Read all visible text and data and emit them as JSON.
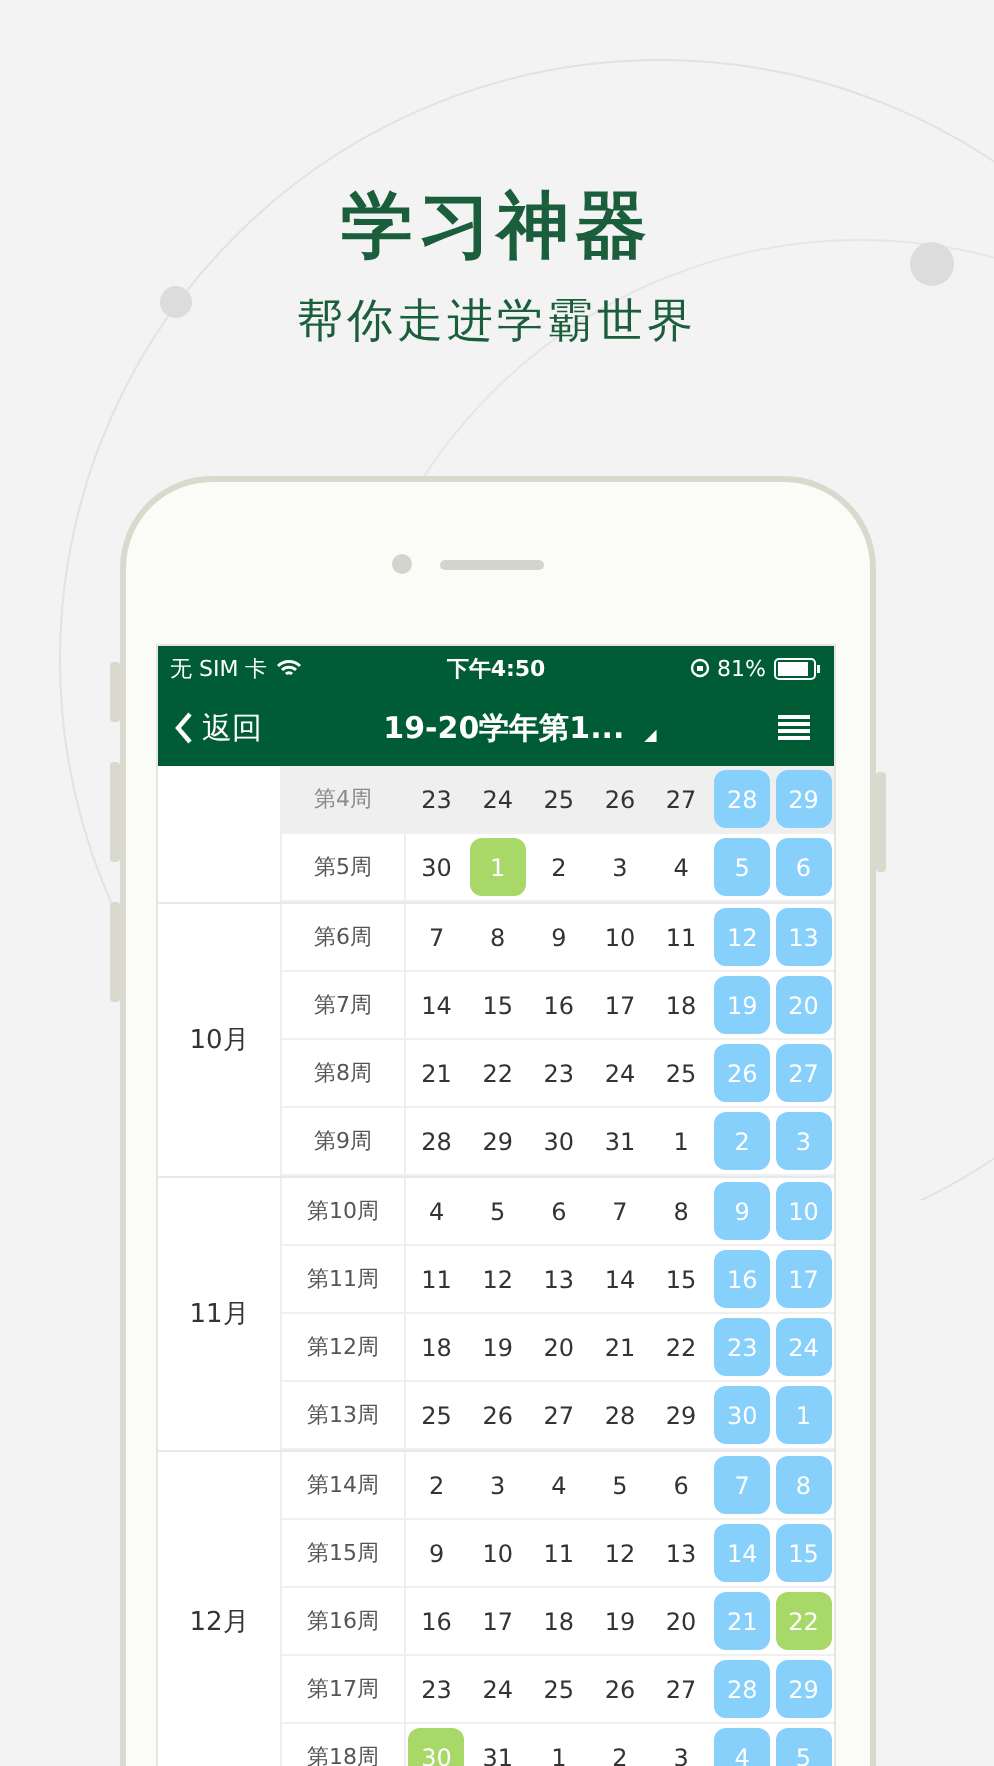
{
  "headline": "学习神器",
  "subtitle": "帮你走进学霸世界",
  "status_bar": {
    "carrier": "无 SIM 卡",
    "time": "下午4:50",
    "battery": "81%"
  },
  "nav_bar": {
    "back": "返回",
    "title": "19-20学年第1...",
    "dropdown": "◢"
  },
  "months": [
    {
      "weeks": [
        {
          "label": "第4周",
          "selected": true,
          "days": [
            {
              "d": "23",
              "kind": "plain"
            },
            {
              "d": "24",
              "kind": "plain"
            },
            {
              "d": "25",
              "kind": "plain"
            },
            {
              "d": "26",
              "kind": "plain"
            },
            {
              "d": "27",
              "kind": "plain"
            },
            {
              "d": "28",
              "kind": "weekend"
            },
            {
              "d": "29",
              "kind": "weekend"
            }
          ]
        },
        {
          "label": "第5周",
          "selected": false,
          "days": [
            {
              "d": "30",
              "kind": "plain"
            },
            {
              "d": "1",
              "kind": "marked"
            },
            {
              "d": "2",
              "kind": "plain"
            },
            {
              "d": "3",
              "kind": "plain"
            },
            {
              "d": "4",
              "kind": "plain"
            },
            {
              "d": "5",
              "kind": "weekend"
            },
            {
              "d": "6",
              "kind": "weekend"
            }
          ]
        }
      ]
    },
    {
      "label": "10月",
      "weeks": [
        {
          "label": "第6周",
          "selected": false,
          "days": [
            {
              "d": "7",
              "kind": "plain"
            },
            {
              "d": "8",
              "kind": "plain"
            },
            {
              "d": "9",
              "kind": "plain"
            },
            {
              "d": "10",
              "kind": "plain"
            },
            {
              "d": "11",
              "kind": "plain"
            },
            {
              "d": "12",
              "kind": "weekend"
            },
            {
              "d": "13",
              "kind": "weekend"
            }
          ]
        },
        {
          "label": "第7周",
          "selected": false,
          "days": [
            {
              "d": "14",
              "kind": "plain"
            },
            {
              "d": "15",
              "kind": "plain"
            },
            {
              "d": "16",
              "kind": "plain"
            },
            {
              "d": "17",
              "kind": "plain"
            },
            {
              "d": "18",
              "kind": "plain"
            },
            {
              "d": "19",
              "kind": "weekend"
            },
            {
              "d": "20",
              "kind": "weekend"
            }
          ]
        },
        {
          "label": "第8周",
          "selected": false,
          "days": [
            {
              "d": "21",
              "kind": "plain"
            },
            {
              "d": "22",
              "kind": "plain"
            },
            {
              "d": "23",
              "kind": "plain"
            },
            {
              "d": "24",
              "kind": "plain"
            },
            {
              "d": "25",
              "kind": "plain"
            },
            {
              "d": "26",
              "kind": "weekend"
            },
            {
              "d": "27",
              "kind": "weekend"
            }
          ]
        },
        {
          "label": "第9周",
          "selected": false,
          "days": [
            {
              "d": "28",
              "kind": "plain"
            },
            {
              "d": "29",
              "kind": "plain"
            },
            {
              "d": "30",
              "kind": "plain"
            },
            {
              "d": "31",
              "kind": "plain"
            },
            {
              "d": "1",
              "kind": "plain"
            },
            {
              "d": "2",
              "kind": "weekend"
            },
            {
              "d": "3",
              "kind": "weekend"
            }
          ]
        }
      ]
    },
    {
      "label": "11月",
      "weeks": [
        {
          "label": "第10周",
          "selected": false,
          "days": [
            {
              "d": "4",
              "kind": "plain"
            },
            {
              "d": "5",
              "kind": "plain"
            },
            {
              "d": "6",
              "kind": "plain"
            },
            {
              "d": "7",
              "kind": "plain"
            },
            {
              "d": "8",
              "kind": "plain"
            },
            {
              "d": "9",
              "kind": "weekend"
            },
            {
              "d": "10",
              "kind": "weekend"
            }
          ]
        },
        {
          "label": "第11周",
          "selected": false,
          "days": [
            {
              "d": "11",
              "kind": "plain"
            },
            {
              "d": "12",
              "kind": "plain"
            },
            {
              "d": "13",
              "kind": "plain"
            },
            {
              "d": "14",
              "kind": "plain"
            },
            {
              "d": "15",
              "kind": "plain"
            },
            {
              "d": "16",
              "kind": "weekend"
            },
            {
              "d": "17",
              "kind": "weekend"
            }
          ]
        },
        {
          "label": "第12周",
          "selected": false,
          "days": [
            {
              "d": "18",
              "kind": "plain"
            },
            {
              "d": "19",
              "kind": "plain"
            },
            {
              "d": "20",
              "kind": "plain"
            },
            {
              "d": "21",
              "kind": "plain"
            },
            {
              "d": "22",
              "kind": "plain"
            },
            {
              "d": "23",
              "kind": "weekend"
            },
            {
              "d": "24",
              "kind": "weekend"
            }
          ]
        },
        {
          "label": "第13周",
          "selected": false,
          "days": [
            {
              "d": "25",
              "kind": "plain"
            },
            {
              "d": "26",
              "kind": "plain"
            },
            {
              "d": "27",
              "kind": "plain"
            },
            {
              "d": "28",
              "kind": "plain"
            },
            {
              "d": "29",
              "kind": "plain"
            },
            {
              "d": "30",
              "kind": "weekend"
            },
            {
              "d": "1",
              "kind": "weekend"
            }
          ]
        }
      ]
    },
    {
      "label": "12月",
      "weeks": [
        {
          "label": "第14周",
          "selected": false,
          "days": [
            {
              "d": "2",
              "kind": "plain"
            },
            {
              "d": "3",
              "kind": "plain"
            },
            {
              "d": "4",
              "kind": "plain"
            },
            {
              "d": "5",
              "kind": "plain"
            },
            {
              "d": "6",
              "kind": "plain"
            },
            {
              "d": "7",
              "kind": "weekend"
            },
            {
              "d": "8",
              "kind": "weekend"
            }
          ]
        },
        {
          "label": "第15周",
          "selected": false,
          "days": [
            {
              "d": "9",
              "kind": "plain"
            },
            {
              "d": "10",
              "kind": "plain"
            },
            {
              "d": "11",
              "kind": "plain"
            },
            {
              "d": "12",
              "kind": "plain"
            },
            {
              "d": "13",
              "kind": "plain"
            },
            {
              "d": "14",
              "kind": "weekend"
            },
            {
              "d": "15",
              "kind": "weekend"
            }
          ]
        },
        {
          "label": "第16周",
          "selected": false,
          "days": [
            {
              "d": "16",
              "kind": "plain"
            },
            {
              "d": "17",
              "kind": "plain"
            },
            {
              "d": "18",
              "kind": "plain"
            },
            {
              "d": "19",
              "kind": "plain"
            },
            {
              "d": "20",
              "kind": "plain"
            },
            {
              "d": "21",
              "kind": "weekend"
            },
            {
              "d": "22",
              "kind": "marked"
            }
          ]
        },
        {
          "label": "第17周",
          "selected": false,
          "days": [
            {
              "d": "23",
              "kind": "plain"
            },
            {
              "d": "24",
              "kind": "plain"
            },
            {
              "d": "25",
              "kind": "plain"
            },
            {
              "d": "26",
              "kind": "plain"
            },
            {
              "d": "27",
              "kind": "plain"
            },
            {
              "d": "28",
              "kind": "weekend"
            },
            {
              "d": "29",
              "kind": "weekend"
            }
          ]
        },
        {
          "label": "第18周",
          "selected": false,
          "days": [
            {
              "d": "30",
              "kind": "marked"
            },
            {
              "d": "31",
              "kind": "plain"
            },
            {
              "d": "1",
              "kind": "plain"
            },
            {
              "d": "2",
              "kind": "plain"
            },
            {
              "d": "3",
              "kind": "plain"
            },
            {
              "d": "4",
              "kind": "weekend"
            },
            {
              "d": "5",
              "kind": "weekend"
            }
          ]
        }
      ]
    }
  ]
}
